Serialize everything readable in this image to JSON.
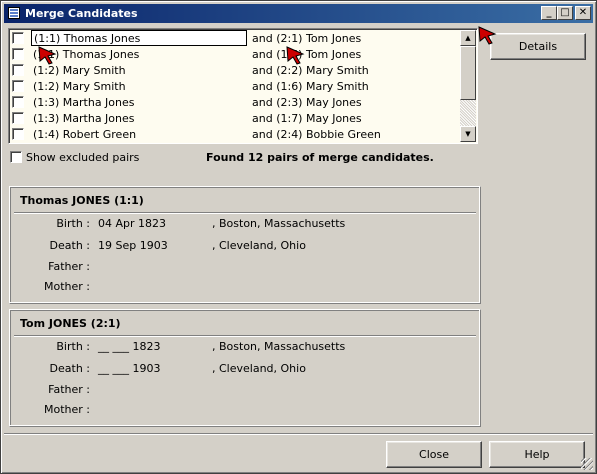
{
  "window": {
    "title": "Merge Candidates",
    "controls": {
      "minimize": "_",
      "maximize": "□",
      "close": "✕"
    }
  },
  "list": {
    "rows": [
      {
        "left": "(1:1) Thomas Jones",
        "right": "and (2:1) Tom Jones"
      },
      {
        "left": "(1:1) Thomas Jones",
        "right": "and (1:5) Tom Jones"
      },
      {
        "left": "(1:2) Mary Smith",
        "right": "and (2:2) Mary Smith"
      },
      {
        "left": "(1:2) Mary Smith",
        "right": "and (1:6) Mary Smith"
      },
      {
        "left": "(1:3) Martha Jones",
        "right": "and (2:3) May Jones"
      },
      {
        "left": "(1:3) Martha Jones",
        "right": "and (1:7) May Jones"
      },
      {
        "left": "(1:4) Robert Green",
        "right": "and (2:4) Bobbie Green"
      }
    ]
  },
  "details_label": "Details",
  "show_excluded_label": "Show excluded pairs",
  "found_text": "Found 12 pairs of merge candidates.",
  "panel1": {
    "title": "Thomas JONES (1:1)",
    "birth_label": "Birth :",
    "birth_date": "04 Apr 1823",
    "birth_place": ", Boston, Massachusetts",
    "death_label": "Death :",
    "death_date": "19 Sep 1903",
    "death_place": ", Cleveland, Ohio",
    "father_label": "Father :",
    "mother_label": "Mother :"
  },
  "panel2": {
    "title": "Tom JONES (2:1)",
    "birth_label": "Birth :",
    "birth_date": "__ ___ 1823",
    "birth_place": ", Boston, Massachusetts",
    "death_label": "Death :",
    "death_date": "__ ___ 1903",
    "death_place": ", Cleveland, Ohio",
    "father_label": "Father :",
    "mother_label": "Mother :"
  },
  "buttons": {
    "close": "Close",
    "help": "Help"
  },
  "colors": {
    "titlebar": "#0a246a",
    "list_bg": "#fefcf0",
    "face": "#d4d0c8",
    "cursor": "#cc0000"
  },
  "icons": [
    "window-icon",
    "minimize-icon",
    "maximize-icon",
    "close-icon",
    "scroll-up-icon",
    "scroll-down-icon",
    "pointer-cursor-icon"
  ]
}
